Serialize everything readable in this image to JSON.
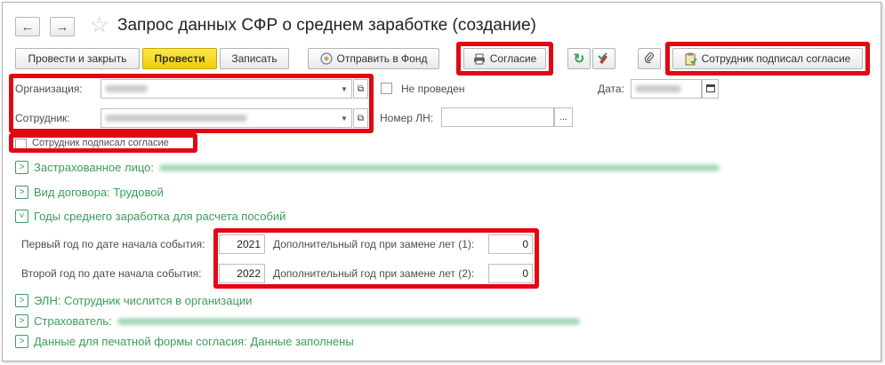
{
  "window": {
    "title": "Запрос данных СФР о среднем заработке (создание)",
    "back_icon": "←",
    "forward_icon": "→",
    "star_icon": "☆"
  },
  "toolbar": {
    "post_and_close": "Провести и закрыть",
    "post": "Провести",
    "save": "Записать",
    "send_to_fund": "Отправить в Фонд",
    "consent": "Согласие",
    "refresh_icon": "↻",
    "clip_icon": "📎",
    "employee_signed": "Сотрудник подписал согласие"
  },
  "form": {
    "organization_label": "Организация:",
    "employee_label": "Сотрудник:",
    "status": "Не проведен",
    "date_label": "Дата:",
    "sick_leave_label": "Номер ЛН:",
    "sick_leave_button": "...",
    "consent_checkbox_label": "Сотрудник подписал согласие"
  },
  "sections": {
    "insured": "Застрахованное лицо:",
    "contract": "Вид договора: Трудовой",
    "years": "Годы среднего заработка для расчета пособий",
    "eln": "ЭЛН: Сотрудник числится в организации",
    "insurer": "Страхователь:",
    "print_data": "Данные для печатной формы согласия: Данные заполнены"
  },
  "years": {
    "first_label": "Первый год по дате начала события:",
    "first_value": "2021",
    "second_label": "Второй год по дате начала события:",
    "second_value": "2022",
    "extra1_label": "Дополнительный год при замене лет (1):",
    "extra1_value": "0",
    "extra2_label": "Дополнительный год при замене лет (2):",
    "extra2_value": "0"
  },
  "colors": {
    "accent_green": "#3a9d5d",
    "highlight_red": "#e30613",
    "primary_yellow": "#f3cc06"
  }
}
